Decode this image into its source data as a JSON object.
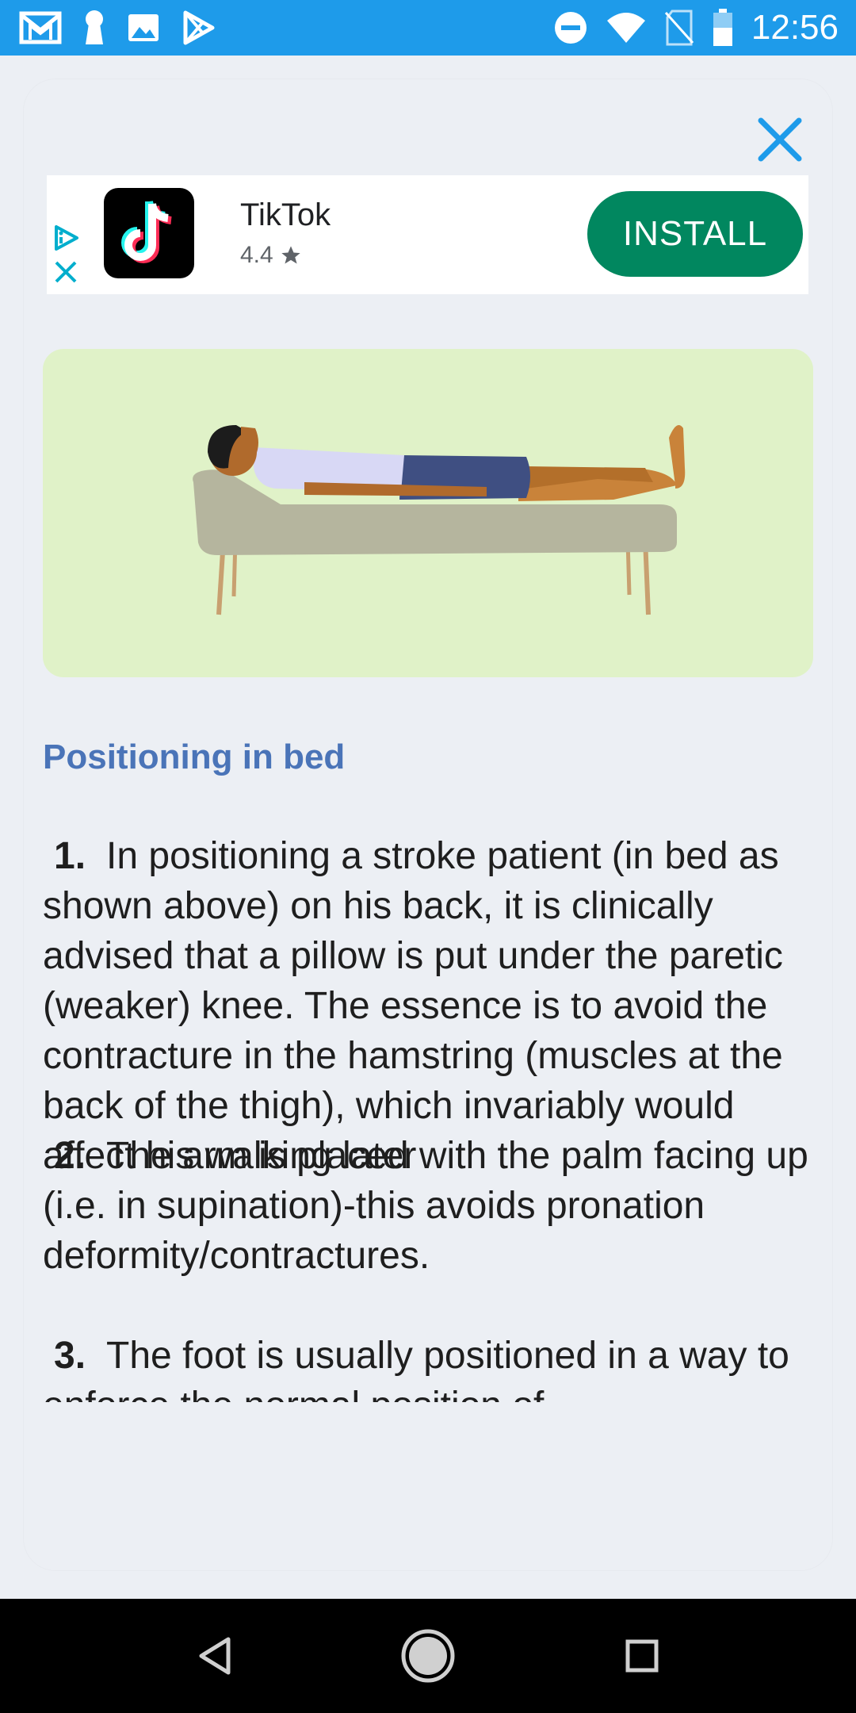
{
  "status_bar": {
    "time": "12:56",
    "left_icons": [
      "gmail-icon",
      "keyhole-icon",
      "image-icon",
      "play-store-icon"
    ],
    "right_icons": [
      "do-not-disturb-icon",
      "wifi-icon",
      "no-sim-icon",
      "battery-icon"
    ]
  },
  "ad": {
    "app_name": "TikTok",
    "rating": "4.4",
    "install_label": "INSTALL",
    "colors": {
      "install_bg": "#01875f",
      "adchoices": "#00aecd"
    }
  },
  "content": {
    "section_title": "Positioning in bed",
    "paragraphs": [
      {
        "number": "1.",
        "text": "In positioning a stroke patient (in bed as shown above) on his back, it is clinically advised that a pillow is put under the paretic (weaker) knee. The essence is to avoid the contracture in the hamstring (muscles at the back of the thigh), which invariably would affect his walking later"
      },
      {
        "number": "2.",
        "text": "The arm is placed with the palm facing up (i.e. in supination)-this avoids pronation deformity/contractures."
      },
      {
        "number": "3.",
        "text": "The foot is usually positioned in a way to enforce the normal position of"
      }
    ]
  },
  "colors": {
    "status_bar": "#1e9bea",
    "section_title": "#4a74b8",
    "illustration_bg": "#e0f2c8",
    "close_icon": "#1e9bea"
  },
  "nav": {
    "buttons": [
      "back-icon",
      "home-icon",
      "recents-icon"
    ]
  }
}
